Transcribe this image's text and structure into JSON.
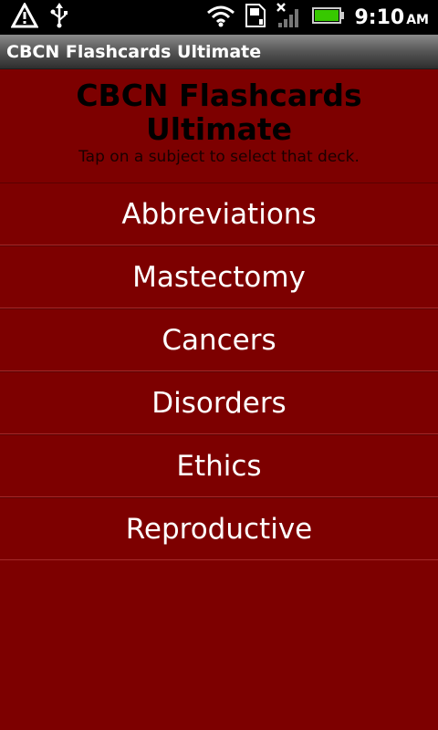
{
  "status_bar": {
    "time": "9:10",
    "ampm": "AM",
    "icons": [
      "warning-icon",
      "usb-icon",
      "wifi-icon",
      "sd-card-icon",
      "no-signal-icon",
      "battery-icon"
    ]
  },
  "title_bar": {
    "title": "CBCN Flashcards Ultimate"
  },
  "header": {
    "heading": "CBCN Flashcards Ultimate",
    "subtitle": "Tap on a subject to select that deck."
  },
  "decks": [
    {
      "label": "Abbreviations"
    },
    {
      "label": "Mastectomy"
    },
    {
      "label": "Cancers"
    },
    {
      "label": "Disorders"
    },
    {
      "label": "Ethics"
    },
    {
      "label": "Reproductive"
    }
  ],
  "colors": {
    "background": "#7d0000",
    "status_bar": "#000000",
    "heading_text": "#000000",
    "item_text": "#ffffff",
    "battery": "#37c800"
  }
}
